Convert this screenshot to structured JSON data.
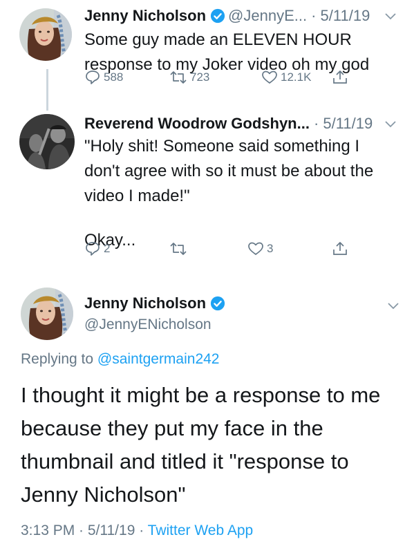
{
  "tweet1": {
    "name": "Jenny Nicholson",
    "handle": "@JennyE...",
    "date": "· 5/11/19",
    "text_lines": [
      "Some guy made an ELEVEN HOUR",
      "response to my Joker video oh my god"
    ],
    "replies": "588",
    "retweets": "723",
    "likes": "12.1K"
  },
  "tweet2": {
    "name": "Reverend Woodrow Godshyn...",
    "date": "· 5/11/19",
    "text_lines": [
      "\"Holy shit! Someone said something I",
      "don't agree with so it must be about the",
      "video I made!\""
    ],
    "text_extra": "Okay...",
    "replies": "2",
    "likes": "3"
  },
  "main_tweet": {
    "name": "Jenny Nicholson",
    "handle": "@JennyENicholson",
    "replying_prefix": "Replying to ",
    "replying_to": "@saintgermain242",
    "text_lines": [
      "I thought it might be a response to me",
      "because they put my face in the",
      "thumbnail and titled it \"response to",
      "Jenny Nicholson\""
    ],
    "time": "3:13 PM · 5/11/19 · ",
    "source": "Twitter Web App"
  },
  "colors": {
    "accent": "#1da1f2",
    "secondary_text": "#657786",
    "thread_line": "#ccd6dd"
  },
  "icons": [
    "verified-badge-icon",
    "chevron-down-icon",
    "reply-icon",
    "retweet-icon",
    "like-icon",
    "share-icon"
  ]
}
